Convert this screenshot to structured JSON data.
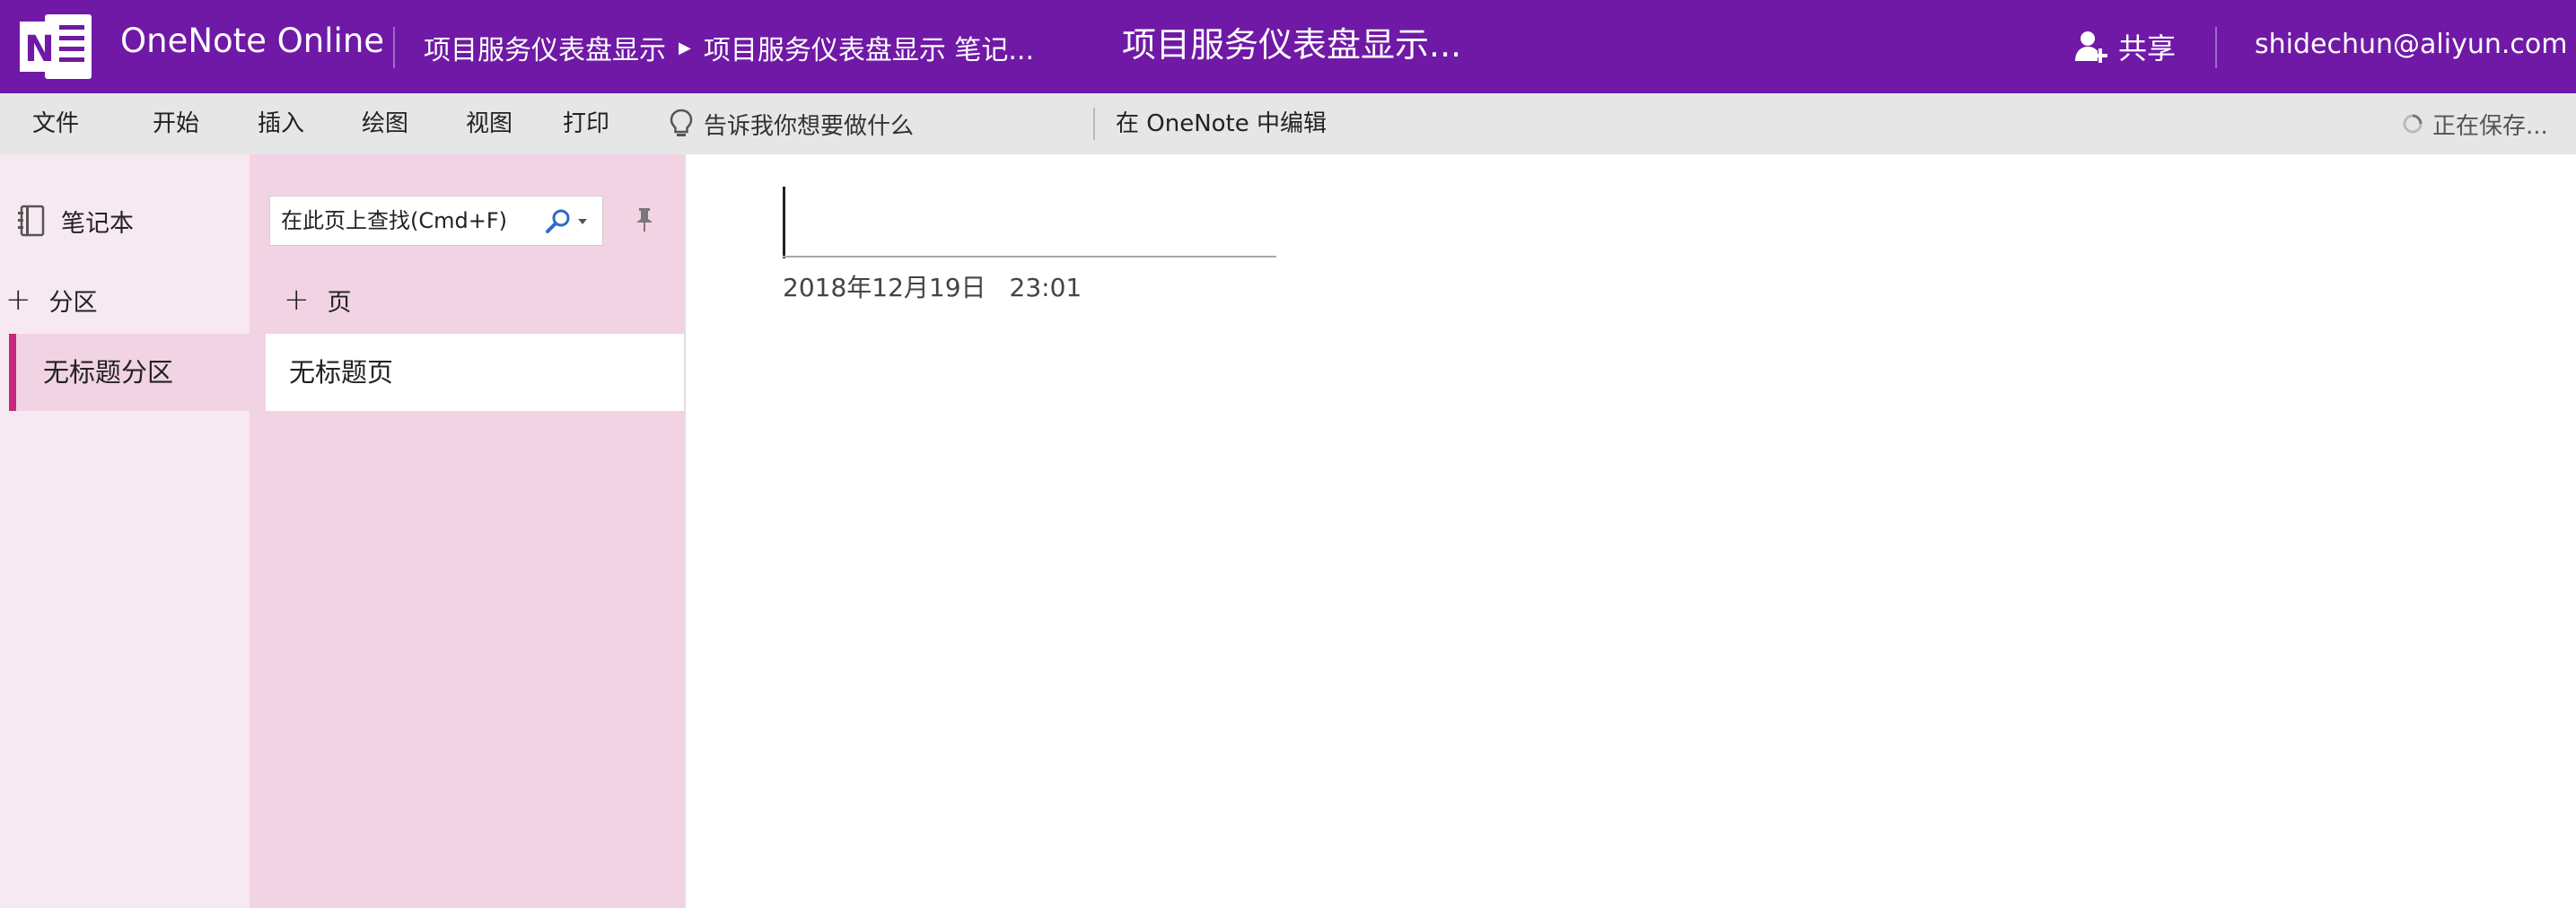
{
  "app": {
    "name": "OneNote Online",
    "logo_letter": "N"
  },
  "header": {
    "breadcrumb": [
      "项目服务仪表盘显示",
      "项目服务仪表盘显示 笔记..."
    ],
    "page_title": "项目服务仪表盘显示...",
    "share_label": "共享",
    "user_email": "shidechun@aliyun.com"
  },
  "menubar": {
    "items": [
      "文件",
      "开始",
      "插入",
      "绘图",
      "视图",
      "打印"
    ],
    "tell_me": "告诉我你想要做什么",
    "edit_in_desktop": "在 OneNote 中编辑",
    "status": "正在保存..."
  },
  "sidebar": {
    "notebook_label": "笔记本",
    "add_section_label": "分区",
    "sections": [
      {
        "label": "无标题分区",
        "selected": true
      }
    ]
  },
  "pages_pane": {
    "search_placeholder": "在此页上查找(Cmd+F)",
    "add_page_label": "页",
    "pages": [
      {
        "label": "无标题页",
        "selected": true
      }
    ]
  },
  "canvas": {
    "title": "",
    "date": "2018年12月19日",
    "time": "23:01"
  },
  "colors": {
    "brand": "#7019a6",
    "section_accent": "#c6287f",
    "sections_bg": "#f7e9f1",
    "pages_bg": "#f1d3e4"
  },
  "icons": [
    "onenote-logo-icon",
    "share-person-icon",
    "lightbulb-icon",
    "spinner-icon",
    "notebook-icon",
    "search-icon",
    "chevron-down-icon",
    "pin-icon"
  ]
}
